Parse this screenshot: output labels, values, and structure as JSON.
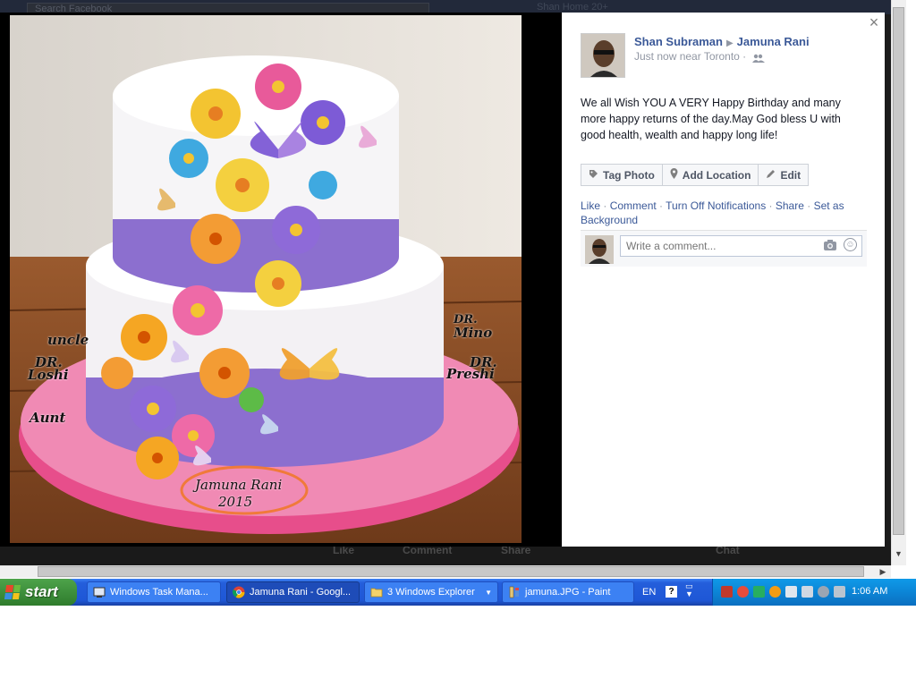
{
  "background_page": {
    "search_placeholder": "Search Facebook",
    "topnav": "Shan   Home   20+",
    "actionbar": {
      "like": "Like",
      "comment": "Comment",
      "share": "Share",
      "chat": "Chat"
    }
  },
  "photo": {
    "overlay_labels": {
      "uncle": "uncle",
      "dr_loshi_1": "DR.",
      "dr_loshi_2": "Loshi",
      "aunt": "Aunt",
      "dr_mino_1": "DR.",
      "dr_mino_2": "Mino",
      "dr_preshi_1": "DR.",
      "dr_preshi_2": "Preshi",
      "name": "Jamuna Rani",
      "year": "2015"
    }
  },
  "panel": {
    "close": "×",
    "author": "Shan Subraman",
    "recipient": "Jamuna Rani",
    "meta": "Just now near Toronto ·",
    "caption": "We all Wish YOU A VERY Happy Birthday and many more happy returns of the day.May God bless U with good health, wealth and happy long life!",
    "buttons": {
      "tag_photo": "Tag Photo",
      "add_location": "Add Location",
      "edit": "Edit"
    },
    "ufi": {
      "like": "Like",
      "comment": "Comment",
      "notifications": "Turn Off Notifications",
      "share": "Share",
      "background": "Set as Background"
    },
    "comment_placeholder": "Write a comment..."
  },
  "taskbar": {
    "start": "start",
    "tasks": [
      {
        "label": "Windows Task Mana..."
      },
      {
        "label": "Jamuna Rani - Googl..."
      },
      {
        "label": "3 Windows Explorer"
      },
      {
        "label": "jamuna.JPG - Paint"
      }
    ],
    "language": "EN",
    "help": "?",
    "clock": "1:06 AM"
  },
  "colors": {
    "fb_blue": "#3b5998",
    "taskbar_blue": "#245edb",
    "start_green": "#3c8d3a",
    "tray_blue": "#0c85d6"
  }
}
